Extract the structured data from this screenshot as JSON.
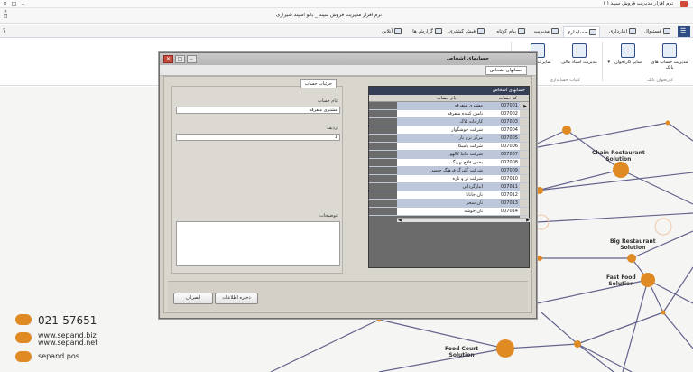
{
  "app": {
    "title": "نرم افزار مدیریت فروش سپند ( )",
    "subtitle": "نرم افزار مدیریت فروش سپند _ بانو اسپند شیرازی"
  },
  "tabs": [
    {
      "label": "فستیوال"
    },
    {
      "label": "انبارداری"
    },
    {
      "label": "حسابداری"
    },
    {
      "label": "مدیریت"
    },
    {
      "label": "پیام کوتاه"
    },
    {
      "label": "فیش کشتری"
    },
    {
      "label": "گزارش ها"
    },
    {
      "label": "آنلاین"
    }
  ],
  "ribbon": {
    "buttons": [
      {
        "label": "مدیریت حساب های بانک"
      },
      {
        "label": "سایر کارتخوان"
      },
      {
        "label": "مدیریت اسناد مالی"
      },
      {
        "label": "سایر تنظیمات"
      }
    ],
    "groups": [
      {
        "label": "کارتخوان بانک"
      },
      {
        "label": "کلیات حسابداری"
      }
    ]
  },
  "background": {
    "labels": {
      "chain": "Chain Restaurant Solution",
      "big": "Big Restaurant Solution",
      "fastfood": "Fast Food Solution",
      "foodcourt": "Food Court Solution"
    },
    "contact": {
      "phone": "021-57651",
      "site1": "www.sepand.biz",
      "site2": "www.sepand.net",
      "instagram": "sepand.pos"
    }
  },
  "modal": {
    "title": "حسابهای اشخاص",
    "tab": "حسابهای اشخاص",
    "grid": {
      "title": "حسابهای اشخاص",
      "col_code": "کد حساب",
      "col_name": "نام حساب",
      "rows": [
        {
          "code": "007001",
          "name": "مشتری متفرقه"
        },
        {
          "code": "007002",
          "name": "تامین کننده متفرقه"
        },
        {
          "code": "007003",
          "name": "کارخانه پلاک"
        },
        {
          "code": "007004",
          "name": "شرکت خوشگوار"
        },
        {
          "code": "007005",
          "name": "مرکز نرم یار"
        },
        {
          "code": "007006",
          "name": "شرکت پامیکا"
        },
        {
          "code": "007007",
          "name": "شرکت مانیا کالهو"
        },
        {
          "code": "007008",
          "name": "پخش فلاح بهرنگ"
        },
        {
          "code": "007009",
          "name": "شرکت گلبرگ فرهنگ چیسی"
        },
        {
          "code": "007010",
          "name": "شرکت تر و تازه"
        },
        {
          "code": "007011",
          "name": "انبارگردانی"
        },
        {
          "code": "007012",
          "name": "نان جانانا"
        },
        {
          "code": "007013",
          "name": "نان سحر"
        },
        {
          "code": "007014",
          "name": "نان خوشه"
        }
      ]
    },
    "details": {
      "tab": "جزئیات حساب",
      "name_label": "نام حساب:",
      "name_value": "مشتری متفرقه",
      "row_label": "ردیف:",
      "row_value": "1",
      "desc_label": "توضیحات:",
      "desc_value": ""
    },
    "buttons": {
      "save": "ذخیره اطلاعات",
      "cancel": "انصراف"
    }
  }
}
